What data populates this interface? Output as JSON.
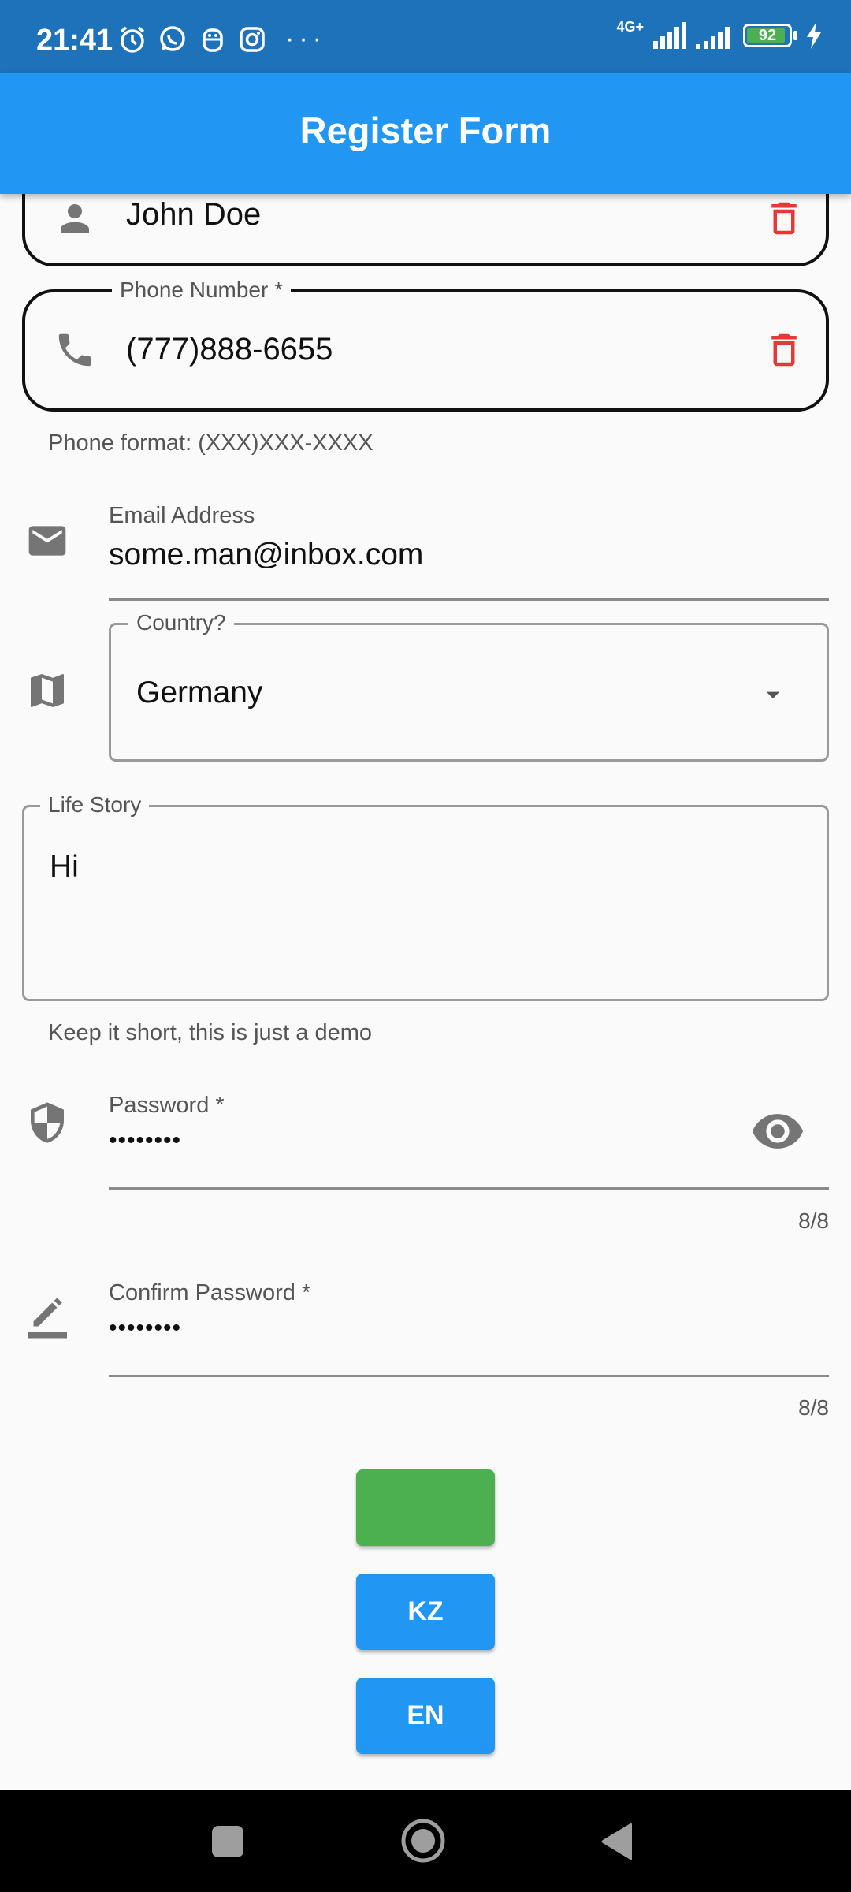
{
  "status_bar": {
    "time": "21:41",
    "network": "4G+",
    "battery": "92",
    "battery_level": 0.92,
    "icons": [
      "alarm-icon",
      "whatsapp-icon",
      "bot-icon",
      "instagram-icon",
      "more-dots-icon",
      "signal-icon",
      "signal-icon",
      "battery-icon",
      "charging-icon"
    ],
    "more": "···"
  },
  "app_bar": {
    "title": "Register Form"
  },
  "form": {
    "name": {
      "value": "John Doe",
      "icon": "person-icon",
      "action_icon": "delete-icon"
    },
    "phone": {
      "label": "Phone Number *",
      "value": "(777)888-6655",
      "helper": "Phone format: (XXX)XXX-XXXX",
      "icon": "phone-icon",
      "action_icon": "delete-icon"
    },
    "email": {
      "label": "Email Address",
      "value": "some.man@inbox.com",
      "icon": "mail-icon"
    },
    "country": {
      "label": "Country?",
      "value": "Germany",
      "icon": "map-icon",
      "dropdown_icon": "arrow-drop-down-icon"
    },
    "life_story": {
      "label": "Life Story",
      "value": "Hi",
      "helper": "Keep it short, this is just a demo"
    },
    "password": {
      "label": "Password *",
      "value": "••••••••",
      "counter": "8/8",
      "icon": "shield-icon",
      "toggle_icon": "eye-icon"
    },
    "confirm_password": {
      "label": "Confirm Password *",
      "value": "••••••••",
      "counter": "8/8",
      "icon": "edit-icon"
    }
  },
  "buttons": {
    "submit": {
      "label": "",
      "color": "#4caf50"
    },
    "kz": {
      "label": "KZ",
      "color": "#2196f3"
    },
    "en": {
      "label": "EN",
      "color": "#2196f3"
    }
  },
  "nav_bar": {
    "icons": [
      "recents-icon",
      "home-icon",
      "back-icon"
    ]
  },
  "colors": {
    "app_bar": "#2196f3",
    "status_bar": "#1e72b9",
    "delete": "#e53935",
    "icon_grey": "#757575",
    "background": "#fafafa"
  }
}
